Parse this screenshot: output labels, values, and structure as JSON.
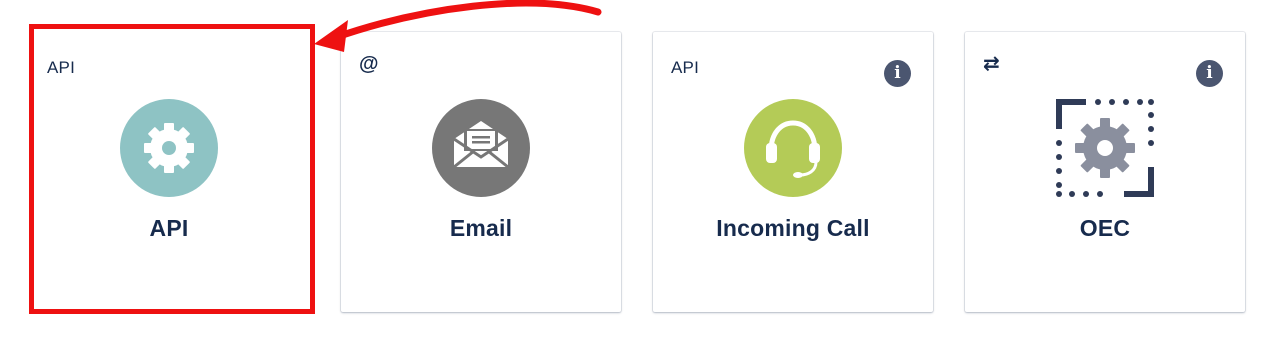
{
  "cards": [
    {
      "tag": "API",
      "title": "API",
      "icon": "gear-icon",
      "color": "#8ec3c4",
      "has_info": false
    },
    {
      "tag_icon": "@",
      "title": "Email",
      "icon": "envelope-icon",
      "color": "#777777",
      "has_info": false
    },
    {
      "tag": "API",
      "title": "Incoming Call",
      "icon": "headset-icon",
      "color": "#b4cb57",
      "has_info": true
    },
    {
      "tag_icon": "⇄",
      "title": "OEC",
      "icon": "oec-gear-icon",
      "color": "#2f3b57",
      "has_info": true
    }
  ],
  "info_glyph": "i",
  "annotation": {
    "highlight_color": "#ee1111"
  }
}
